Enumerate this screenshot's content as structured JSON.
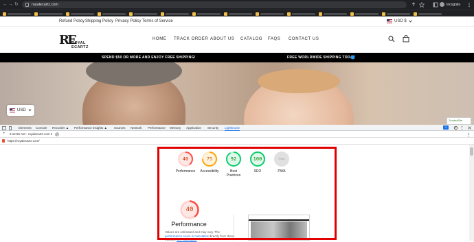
{
  "browser": {
    "url": "royalecartz.com",
    "incognito_label": "Incognito",
    "back_glyph": "←",
    "forward_glyph": "→",
    "reload_glyph": "↻"
  },
  "site": {
    "top_links": [
      "Refund Policy",
      "Shipping Policy",
      "Privacy Policy",
      "Terms of Service"
    ],
    "currency": "USD $",
    "logo_mark": "RE",
    "logo_name": "ROYAL ECARTZ",
    "nav": [
      "HOME",
      "TRACK ORDER",
      "ABOUT US",
      "CATALOG",
      "FAQS",
      "CONTACT US"
    ],
    "promo_left": "SPEND $50 OR MORE AND ENJOY FREE SHIPPING!",
    "promo_right": "FREE WORLDWIDE SHIPPING TODAY",
    "currency_widget": "USD",
    "trusted_badge": "TrustedSite"
  },
  "devtools": {
    "tabs": [
      "Elements",
      "Console",
      "Recorder ▲",
      "Performance insights ▲",
      "Sources",
      "Network",
      "Performance",
      "Memory",
      "Application",
      "Security",
      "Lighthouse"
    ],
    "active_tab": "Lighthouse",
    "report_select": "6:12:55 AM - royalecartz.com ▾",
    "report_url": "https://royalecartz.com/",
    "badge_count": "1"
  },
  "lighthouse": {
    "scores": [
      {
        "label": "Performance",
        "value": "40",
        "color": "#c33300",
        "ring": "#ff4e42",
        "fill": 0.4
      },
      {
        "label": "Accessibility",
        "value": "75",
        "color": "#c65a00",
        "ring": "#ffa400",
        "fill": 0.75
      },
      {
        "label": "Best Practices",
        "value": "92",
        "color": "#008800",
        "ring": "#0cce6b",
        "fill": 0.92
      },
      {
        "label": "SEO",
        "value": "100",
        "color": "#008800",
        "ring": "#0cce6b",
        "fill": 1.0
      },
      {
        "label": "PWA",
        "value": "PWA",
        "color": "#9e9e9e",
        "ring": "#e0e0e0",
        "fill": 0
      }
    ],
    "focus_value": "40",
    "focus_title": "Performance",
    "note_start": "Values are estimated and may vary. The ",
    "note_link1": "performance score is calculated",
    "note_mid": " directly from these metrics. ",
    "note_link2": "See calculator."
  }
}
